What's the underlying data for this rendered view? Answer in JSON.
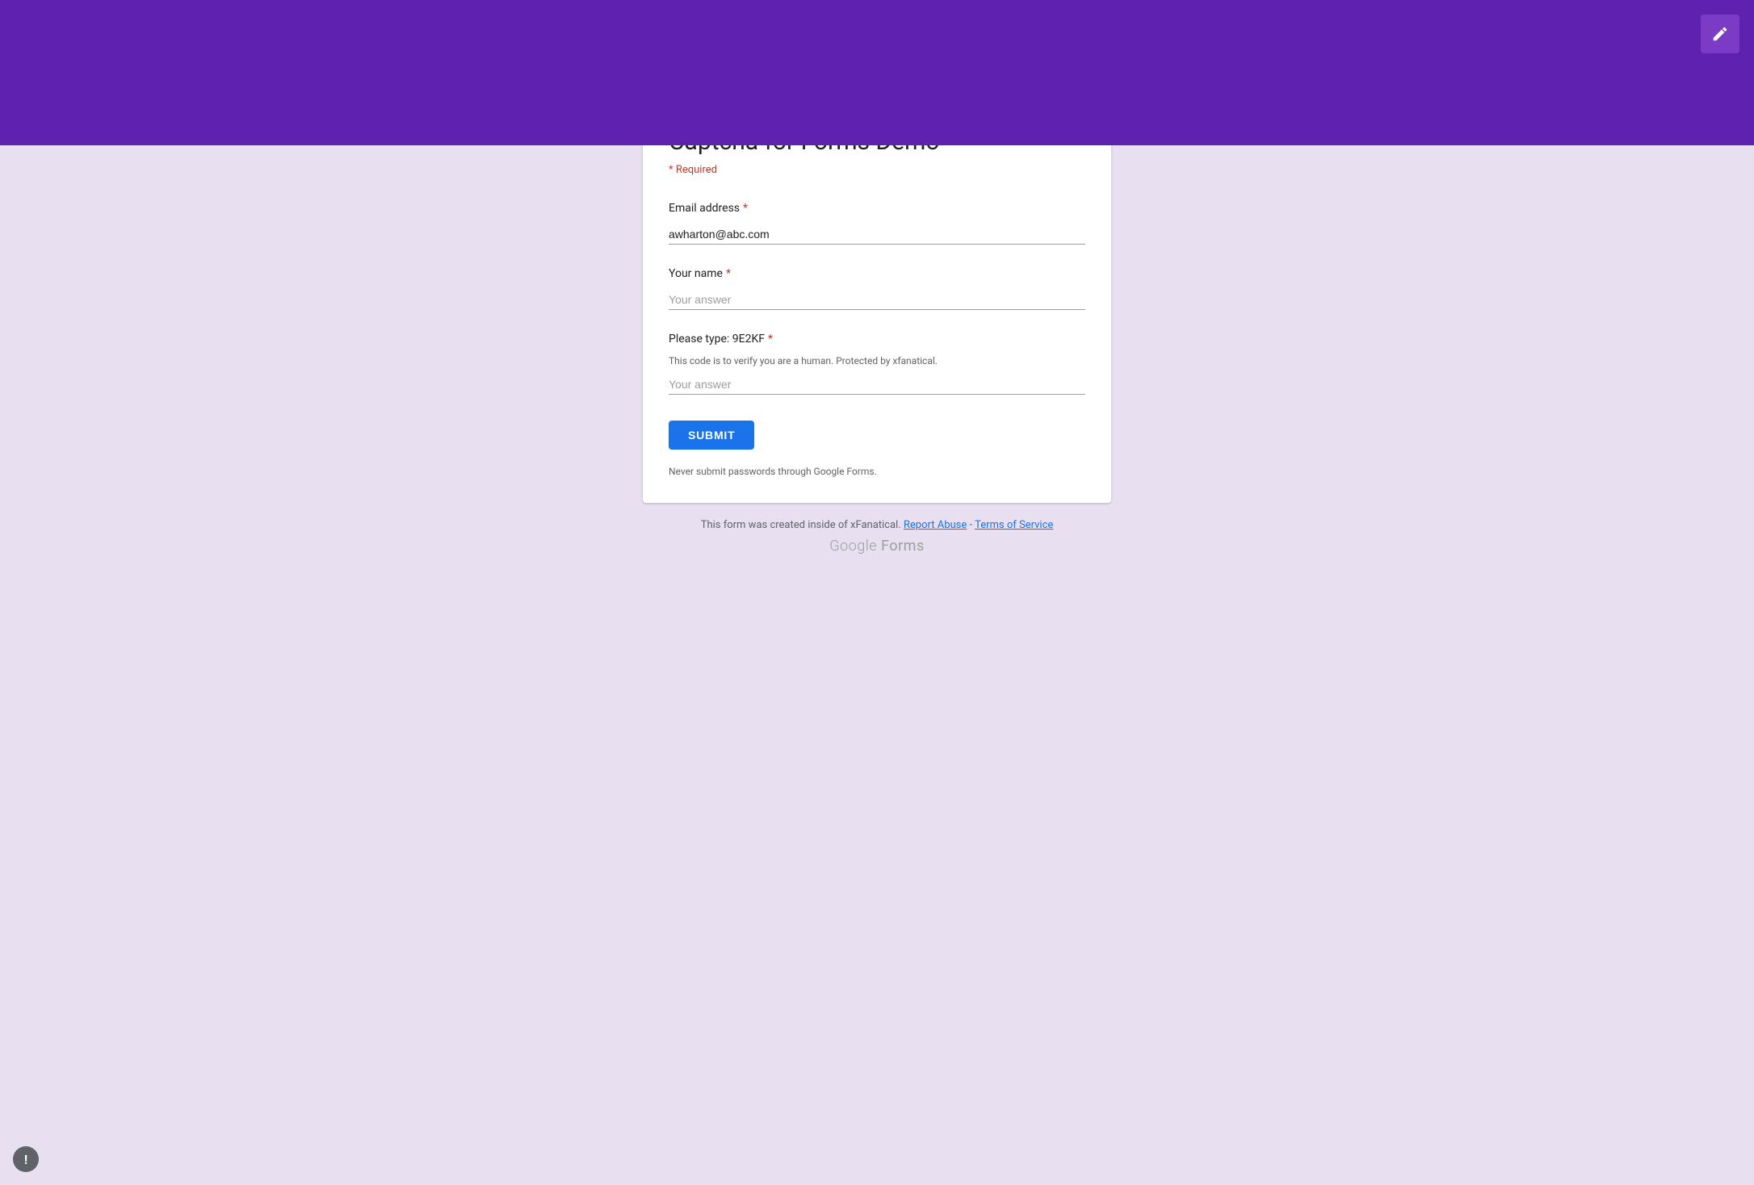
{
  "header": {
    "background_color": "#5f21b0",
    "edit_button_label": "Edit"
  },
  "form": {
    "title": "Captcha for Forms Demo",
    "required_note": "* Required",
    "accent_color": "#9c6fd6",
    "fields": [
      {
        "id": "email",
        "label": "Email address",
        "required": true,
        "type": "text",
        "value": "awharton@abc.com",
        "placeholder": ""
      },
      {
        "id": "name",
        "label": "Your name",
        "required": true,
        "type": "text",
        "value": "",
        "placeholder": "Your answer"
      },
      {
        "id": "captcha",
        "label": "Please type: 9E2KF",
        "required": true,
        "type": "text",
        "value": "",
        "placeholder": "Your answer",
        "description": "This code is to verify you are a human. Protected by xfanatical."
      }
    ],
    "submit_label": "SUBMIT",
    "never_submit_text": "Never submit passwords through Google Forms."
  },
  "footer": {
    "created_text": "This form was created inside of xFanatical.",
    "report_abuse_label": "Report Abuse",
    "terms_label": "Terms of Service",
    "branding_google": "Google",
    "branding_forms": "Forms"
  }
}
